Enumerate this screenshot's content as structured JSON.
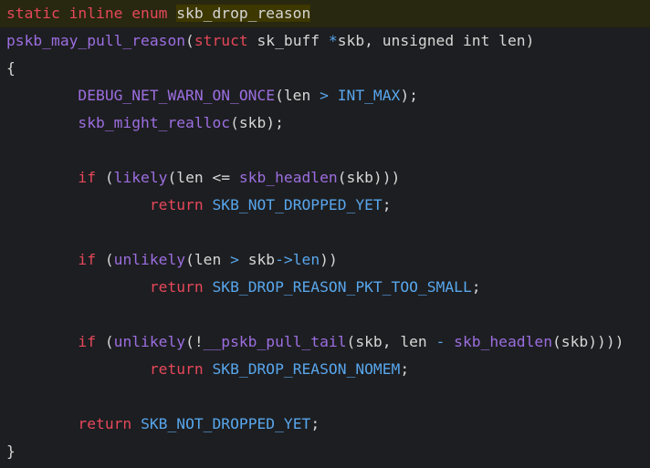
{
  "colors": {
    "background": "#1d1e21",
    "keyword": "#e5485a",
    "function": "#9c6ee0",
    "constant": "#58a6ec",
    "text": "#d6d6d6",
    "highlight": "#3d3700"
  },
  "lines": [
    [
      {
        "t": "static inline enum ",
        "c": "kw"
      },
      {
        "t": "skb_drop_reason",
        "c": "tx hl"
      }
    ],
    [
      {
        "t": "pskb_may_pull_reason",
        "c": "fn"
      },
      {
        "t": "(",
        "c": "tx"
      },
      {
        "t": "struct",
        "c": "kw"
      },
      {
        "t": " sk_buff ",
        "c": "tx"
      },
      {
        "t": "*",
        "c": "op"
      },
      {
        "t": "skb, unsigned int len)",
        "c": "tx"
      }
    ],
    [
      {
        "t": "{",
        "c": "tx"
      }
    ],
    [
      {
        "t": "\t",
        "c": "tx"
      },
      {
        "t": "DEBUG_NET_WARN_ON_ONCE",
        "c": "fn"
      },
      {
        "t": "(len ",
        "c": "tx"
      },
      {
        "t": ">",
        "c": "op"
      },
      {
        "t": " ",
        "c": "tx"
      },
      {
        "t": "INT_MAX",
        "c": "cn"
      },
      {
        "t": ");",
        "c": "tx"
      }
    ],
    [
      {
        "t": "\t",
        "c": "tx"
      },
      {
        "t": "skb_might_realloc",
        "c": "fn"
      },
      {
        "t": "(skb);",
        "c": "tx"
      }
    ],
    [],
    [
      {
        "t": "\t",
        "c": "tx"
      },
      {
        "t": "if",
        "c": "kw"
      },
      {
        "t": " (",
        "c": "tx"
      },
      {
        "t": "likely",
        "c": "fn"
      },
      {
        "t": "(len <= ",
        "c": "tx"
      },
      {
        "t": "skb_headlen",
        "c": "fn"
      },
      {
        "t": "(skb)))",
        "c": "tx"
      }
    ],
    [
      {
        "t": "\t\t",
        "c": "tx"
      },
      {
        "t": "return",
        "c": "kw"
      },
      {
        "t": " ",
        "c": "tx"
      },
      {
        "t": "SKB_NOT_DROPPED_YET",
        "c": "cn"
      },
      {
        "t": ";",
        "c": "tx"
      }
    ],
    [],
    [
      {
        "t": "\t",
        "c": "tx"
      },
      {
        "t": "if",
        "c": "kw"
      },
      {
        "t": " (",
        "c": "tx"
      },
      {
        "t": "unlikely",
        "c": "fn"
      },
      {
        "t": "(len ",
        "c": "tx"
      },
      {
        "t": ">",
        "c": "op"
      },
      {
        "t": " skb",
        "c": "tx"
      },
      {
        "t": "->",
        "c": "op"
      },
      {
        "t": "len",
        "c": "cn"
      },
      {
        "t": "))",
        "c": "tx"
      }
    ],
    [
      {
        "t": "\t\t",
        "c": "tx"
      },
      {
        "t": "return",
        "c": "kw"
      },
      {
        "t": " ",
        "c": "tx"
      },
      {
        "t": "SKB_DROP_REASON_PKT_TOO_SMALL",
        "c": "cn"
      },
      {
        "t": ";",
        "c": "tx"
      }
    ],
    [],
    [
      {
        "t": "\t",
        "c": "tx"
      },
      {
        "t": "if",
        "c": "kw"
      },
      {
        "t": " (",
        "c": "tx"
      },
      {
        "t": "unlikely",
        "c": "fn"
      },
      {
        "t": "(!",
        "c": "tx"
      },
      {
        "t": "__pskb_pull_tail",
        "c": "fn"
      },
      {
        "t": "(skb, len ",
        "c": "tx"
      },
      {
        "t": "-",
        "c": "op"
      },
      {
        "t": " ",
        "c": "tx"
      },
      {
        "t": "skb_headlen",
        "c": "fn"
      },
      {
        "t": "(skb))))",
        "c": "tx"
      }
    ],
    [
      {
        "t": "\t\t",
        "c": "tx"
      },
      {
        "t": "return",
        "c": "kw"
      },
      {
        "t": " ",
        "c": "tx"
      },
      {
        "t": "SKB_DROP_REASON_NOMEM",
        "c": "cn"
      },
      {
        "t": ";",
        "c": "tx"
      }
    ],
    [],
    [
      {
        "t": "\t",
        "c": "tx"
      },
      {
        "t": "return",
        "c": "kw"
      },
      {
        "t": " ",
        "c": "tx"
      },
      {
        "t": "SKB_NOT_DROPPED_YET",
        "c": "cn"
      },
      {
        "t": ";",
        "c": "tx"
      }
    ],
    [
      {
        "t": "}",
        "c": "tx"
      }
    ]
  ]
}
